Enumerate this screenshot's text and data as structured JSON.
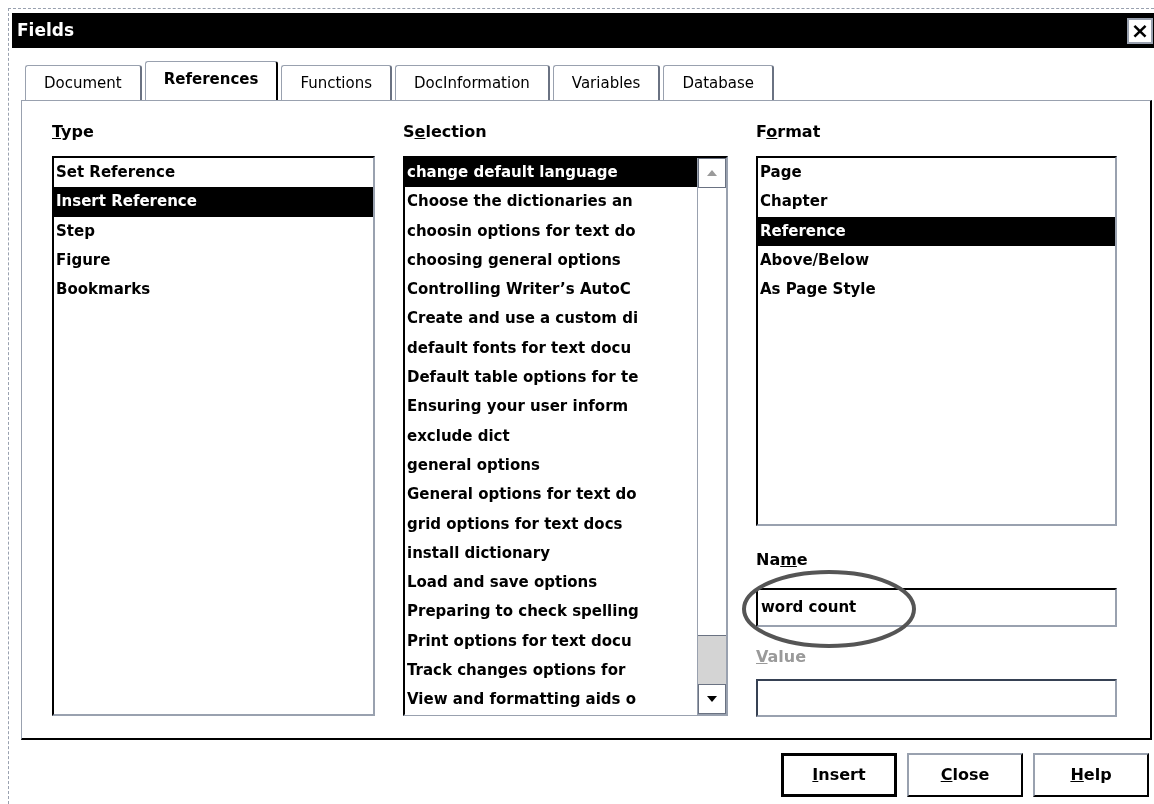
{
  "window": {
    "title": "Fields",
    "close": "×"
  },
  "tabs": [
    {
      "label": "Document",
      "selected": false
    },
    {
      "label": "References",
      "selected": true
    },
    {
      "label": "Functions",
      "selected": false
    },
    {
      "label": "DocInformation",
      "selected": false
    },
    {
      "label": "Variables",
      "selected": false
    },
    {
      "label": "Database",
      "selected": false
    }
  ],
  "type": {
    "mnemonic": "T",
    "rest": "ype",
    "items": [
      {
        "label": "Set Reference",
        "selected": false
      },
      {
        "label": "Insert Reference",
        "selected": true
      },
      {
        "label": "Step",
        "selected": false
      },
      {
        "label": "Figure",
        "selected": false
      },
      {
        "label": "Bookmarks",
        "selected": false
      }
    ]
  },
  "selection": {
    "lead": "S",
    "mnemonic": "e",
    "rest": "lection",
    "items": [
      {
        "label": "change default language",
        "selected": true
      },
      {
        "label": "Choose the dictionaries an",
        "selected": false
      },
      {
        "label": "choosin options for text do",
        "selected": false
      },
      {
        "label": "choosing general options",
        "selected": false
      },
      {
        "label": "Controlling Writer’s AutoC",
        "selected": false
      },
      {
        "label": "Create and use a custom di",
        "selected": false
      },
      {
        "label": "default fonts for text docu",
        "selected": false
      },
      {
        "label": "Default table options for te",
        "selected": false
      },
      {
        "label": "Ensuring your user inform",
        "selected": false
      },
      {
        "label": "exclude dict",
        "selected": false
      },
      {
        "label": "general options",
        "selected": false
      },
      {
        "label": "General options for text do",
        "selected": false
      },
      {
        "label": "grid options for text docs",
        "selected": false
      },
      {
        "label": "install dictionary",
        "selected": false
      },
      {
        "label": "Load and save options",
        "selected": false
      },
      {
        "label": "Preparing to check spelling",
        "selected": false
      },
      {
        "label": "Print options for text docu",
        "selected": false
      },
      {
        "label": "Track changes options for",
        "selected": false
      },
      {
        "label": "View and formatting aids o",
        "selected": false
      }
    ]
  },
  "format": {
    "lead": "F",
    "mnemonic": "o",
    "rest": "rmat",
    "items": [
      {
        "label": "Page",
        "selected": false
      },
      {
        "label": "Chapter",
        "selected": false
      },
      {
        "label": "Reference",
        "selected": true
      },
      {
        "label": "Above/Below",
        "selected": false
      },
      {
        "label": "As Page Style",
        "selected": false
      }
    ]
  },
  "name": {
    "lead": "Na",
    "mnemonic": "m",
    "rest": "e",
    "value": "word count",
    "disabled": false
  },
  "value": {
    "mnemonic": "V",
    "rest": "alue",
    "disabled": true
  },
  "buttons": [
    {
      "mnemonic": "I",
      "rest": "nsert",
      "default": true
    },
    {
      "mnemonic": "C",
      "rest": "lose",
      "default": false
    },
    {
      "mnemonic": "H",
      "rest": "elp",
      "default": false
    }
  ]
}
